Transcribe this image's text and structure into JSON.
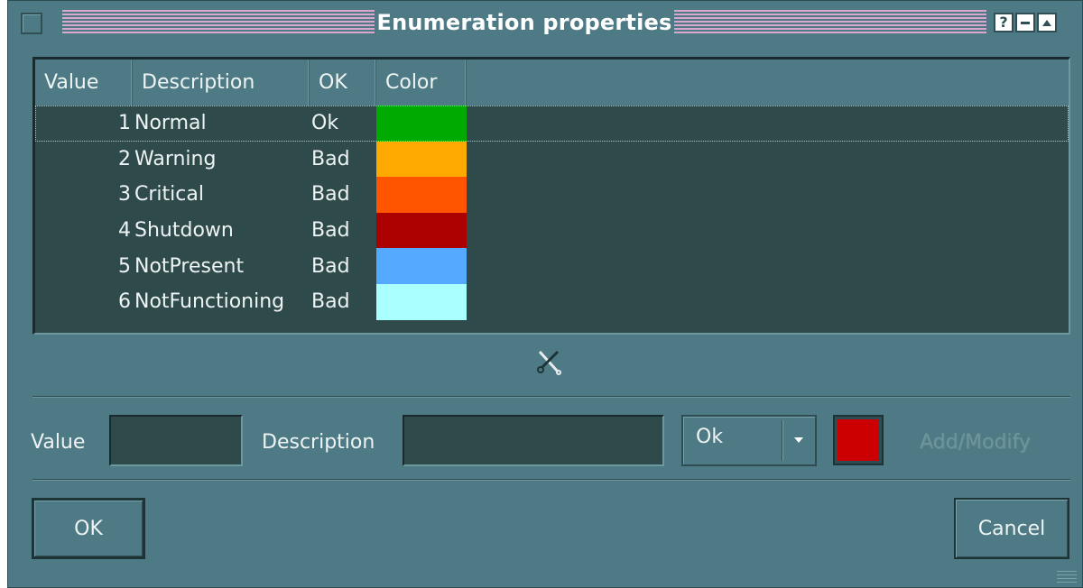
{
  "window": {
    "title": "Enumeration properties",
    "buttons": {
      "help": "?",
      "minimize": "–",
      "maximize": "▲"
    }
  },
  "list": {
    "columns": [
      "Value",
      "Description",
      "OK",
      "Color"
    ],
    "rows": [
      {
        "value": "1",
        "description": "Normal",
        "ok": "Ok",
        "color": "#00aa00",
        "selected": true
      },
      {
        "value": "2",
        "description": "Warning",
        "ok": "Bad",
        "color": "#ffaa00"
      },
      {
        "value": "3",
        "description": "Critical",
        "ok": "Bad",
        "color": "#ff5500"
      },
      {
        "value": "4",
        "description": "Shutdown",
        "ok": "Bad",
        "color": "#aa0000"
      },
      {
        "value": "5",
        "description": "NotPresent",
        "ok": "Bad",
        "color": "#55aaff"
      },
      {
        "value": "6",
        "description": "NotFunctioning",
        "ok": "Bad",
        "color": "#aaffff"
      }
    ]
  },
  "tools": {
    "delete_icon": "scissors-icon"
  },
  "form": {
    "value_label": "Value",
    "value_input": "",
    "description_label": "Description",
    "description_input": "",
    "ok_select_value": "Ok",
    "color_value": "#cc0000",
    "add_modify_label": "Add/Modify"
  },
  "buttons": {
    "ok": "OK",
    "cancel": "Cancel"
  }
}
